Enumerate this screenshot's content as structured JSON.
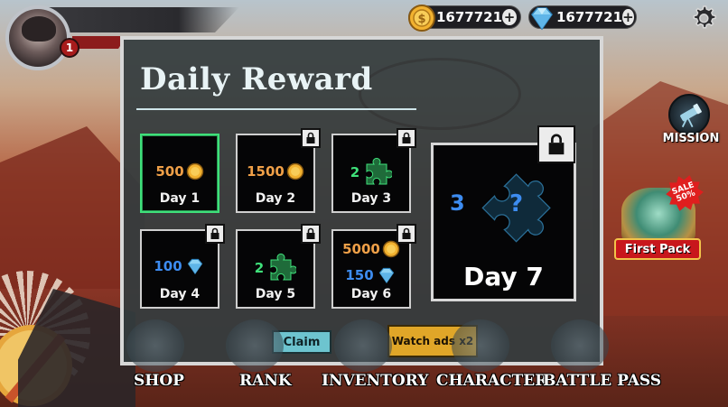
{
  "player": {
    "level": "1"
  },
  "currency": {
    "gold": {
      "value": "1677721",
      "icon": "gold-coin-icon"
    },
    "gems": {
      "value": "1677721",
      "icon": "diamond-icon"
    },
    "plus": "+"
  },
  "side": {
    "mission_label": "MISSION",
    "first_pack_label": "First Pack",
    "sale_line1": "SALE",
    "sale_line2": "50%"
  },
  "daily_reward": {
    "title": "Daily Reward",
    "days": [
      {
        "label": "Day 1",
        "amount": "500",
        "type": "gold",
        "locked": false,
        "claimable": true
      },
      {
        "label": "Day 2",
        "amount": "1500",
        "type": "gold",
        "locked": true
      },
      {
        "label": "Day 3",
        "amount": "2",
        "type": "puzzle",
        "locked": true
      },
      {
        "label": "Day 4",
        "amount": "100",
        "type": "gem",
        "locked": true
      },
      {
        "label": "Day 5",
        "amount": "2",
        "type": "puzzle",
        "locked": true
      },
      {
        "label": "Day 6",
        "amount_gold": "5000",
        "amount_gem": "150",
        "type": "gold+gem",
        "locked": true
      }
    ],
    "day7": {
      "label": "Day 7",
      "amount": "3",
      "type": "mystery-puzzle",
      "locked": true,
      "mystery_mark": "?"
    },
    "claim_label": "Claim",
    "watch_ads_label": "Watch ads x2"
  },
  "nav": {
    "items": [
      "SHOP",
      "RANK",
      "INVENTORY",
      "CHARACTER",
      "BATTLE PASS"
    ]
  },
  "colors": {
    "panel_bg": "#343c3e",
    "active_border": "#3fe07a",
    "claim_button": "#6dc4cf",
    "watch_button": "#e0a628",
    "gold_text": "#f0a048",
    "gem_text": "#3d8cf0"
  }
}
